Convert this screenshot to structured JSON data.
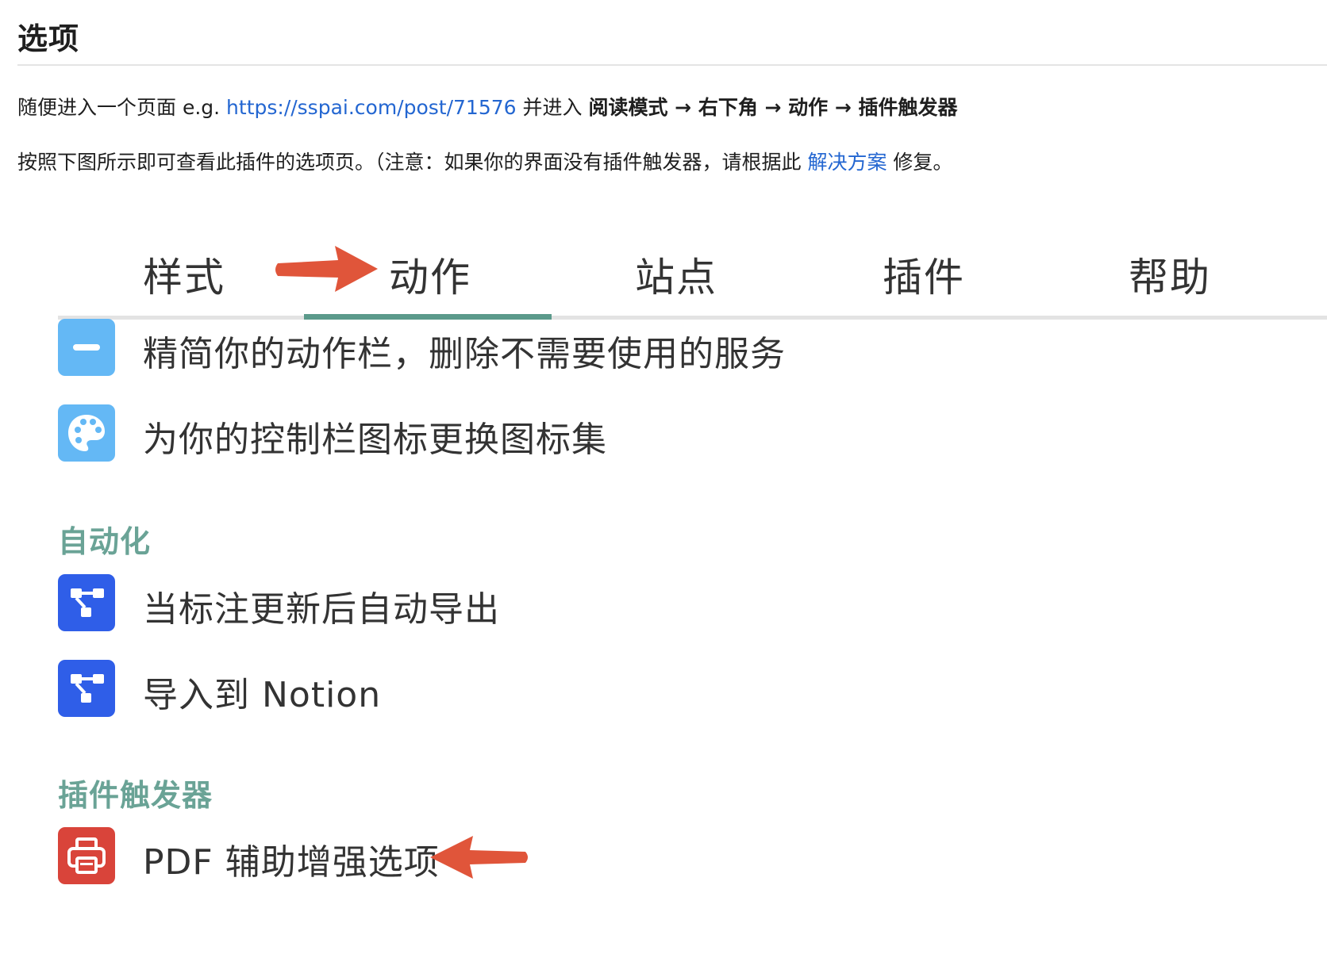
{
  "heading": "选项",
  "para1": {
    "prefix": "随便进入一个页面 e.g. ",
    "link": "https://sspai.com/post/71576",
    "middle": " 并进入 ",
    "bold": "阅读模式 → 右下角 → 动作 → 插件触发器"
  },
  "para2": {
    "prefix": "按照下图所示即可查看此插件的选项页。（注意：如果你的界面没有插件触发器，请根据此 ",
    "link": "解决方案",
    "suffix": " 修复。"
  },
  "tabs": [
    "样式",
    "动作",
    "站点",
    "插件",
    "帮助"
  ],
  "active_tab": "动作",
  "items": [
    {
      "label": "精简你的动作栏，删除不需要使用的服务",
      "icon": "minus-icon",
      "color": "#64b8f5"
    },
    {
      "label": "为你的控制栏图标更换图标集",
      "icon": "palette-icon",
      "color": "#64b8f5"
    }
  ],
  "sections": [
    {
      "title": "自动化",
      "items": [
        {
          "label": "当标注更新后自动导出",
          "icon": "workflow-icon",
          "color": "#2f5ee8"
        },
        {
          "label": "导入到 Notion",
          "icon": "workflow-icon",
          "color": "#2f5ee8"
        }
      ]
    },
    {
      "title": "插件触发器",
      "items": [
        {
          "label": "PDF 辅助增强选项",
          "icon": "printer-icon",
          "color": "#d9443a"
        }
      ]
    }
  ],
  "colors": {
    "accent": "#5b9a8b",
    "link": "#2366d1",
    "arrow": "#e0553a"
  }
}
